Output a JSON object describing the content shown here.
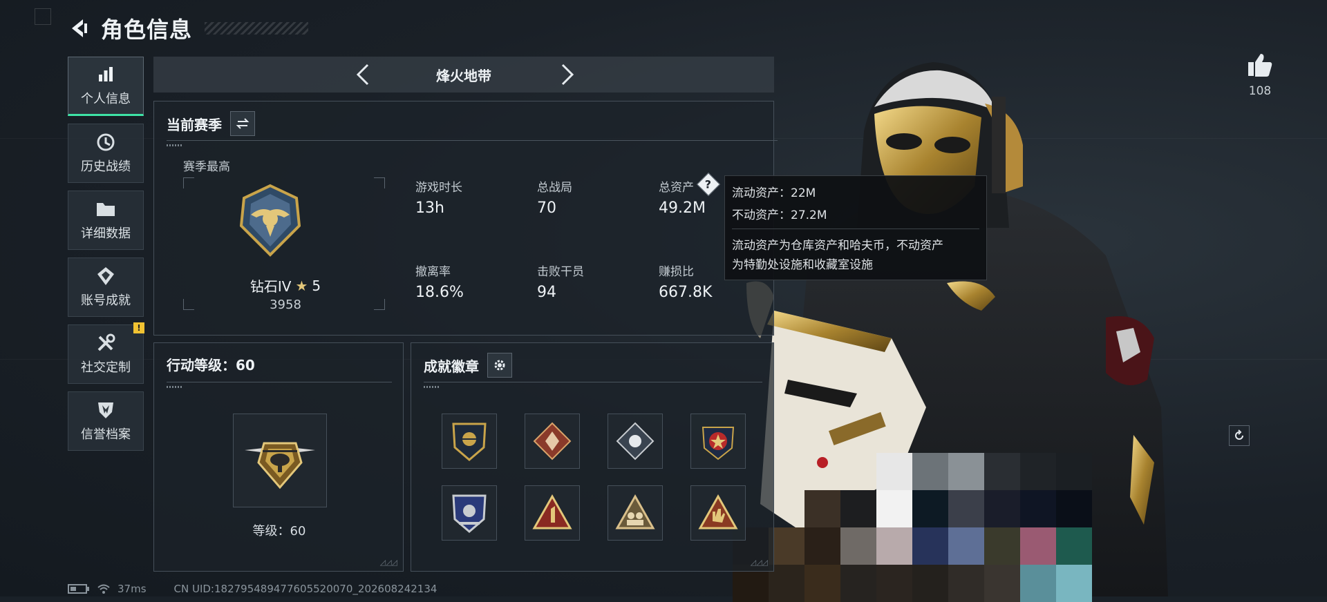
{
  "header": {
    "title": "角色信息"
  },
  "sidebar": {
    "items": [
      {
        "label": "个人信息",
        "icon": "bar-chart-icon",
        "active": true
      },
      {
        "label": "历史战绩",
        "icon": "history-icon",
        "active": false
      },
      {
        "label": "详细数据",
        "icon": "folder-icon",
        "active": false
      },
      {
        "label": "账号成就",
        "icon": "achievement-icon",
        "active": false
      },
      {
        "label": "社交定制",
        "icon": "tools-icon",
        "active": false,
        "badge": "!"
      },
      {
        "label": "信誉档案",
        "icon": "credit-shield-icon",
        "active": false
      }
    ]
  },
  "mode": {
    "title": "烽火地带"
  },
  "season": {
    "title": "当前赛季",
    "best_label": "赛季最高",
    "rank_name": "钻石IV",
    "rank_stars": "5",
    "rank_points": "3958",
    "stats": [
      {
        "label": "游戏时长",
        "value": "13h"
      },
      {
        "label": "总战局",
        "value": "70"
      },
      {
        "label": "总资产",
        "value": "49.2M"
      },
      {
        "label": "撤离率",
        "value": "18.6%"
      },
      {
        "label": "击败干员",
        "value": "94"
      },
      {
        "label": "赚损比",
        "value": "667.8K"
      }
    ]
  },
  "tooltip": {
    "liquid": "流动资产：22M",
    "fixed": "不动资产：27.2M",
    "desc1": "流动资产为仓库资产和哈夫币，不动资产",
    "desc2": "为特勤处设施和收藏室设施"
  },
  "action_level": {
    "title": "行动等级：60",
    "level_text": "等级：60"
  },
  "achievements": {
    "title": "成就徽章"
  },
  "likes": {
    "count": "108"
  },
  "status": {
    "ping": "37ms",
    "uid": "CN UID:1827954894776055200​70_202608242134"
  },
  "colors": {
    "accent": "#3ee3a6",
    "warn": "#f1c232",
    "gold": "#c9a44a"
  }
}
